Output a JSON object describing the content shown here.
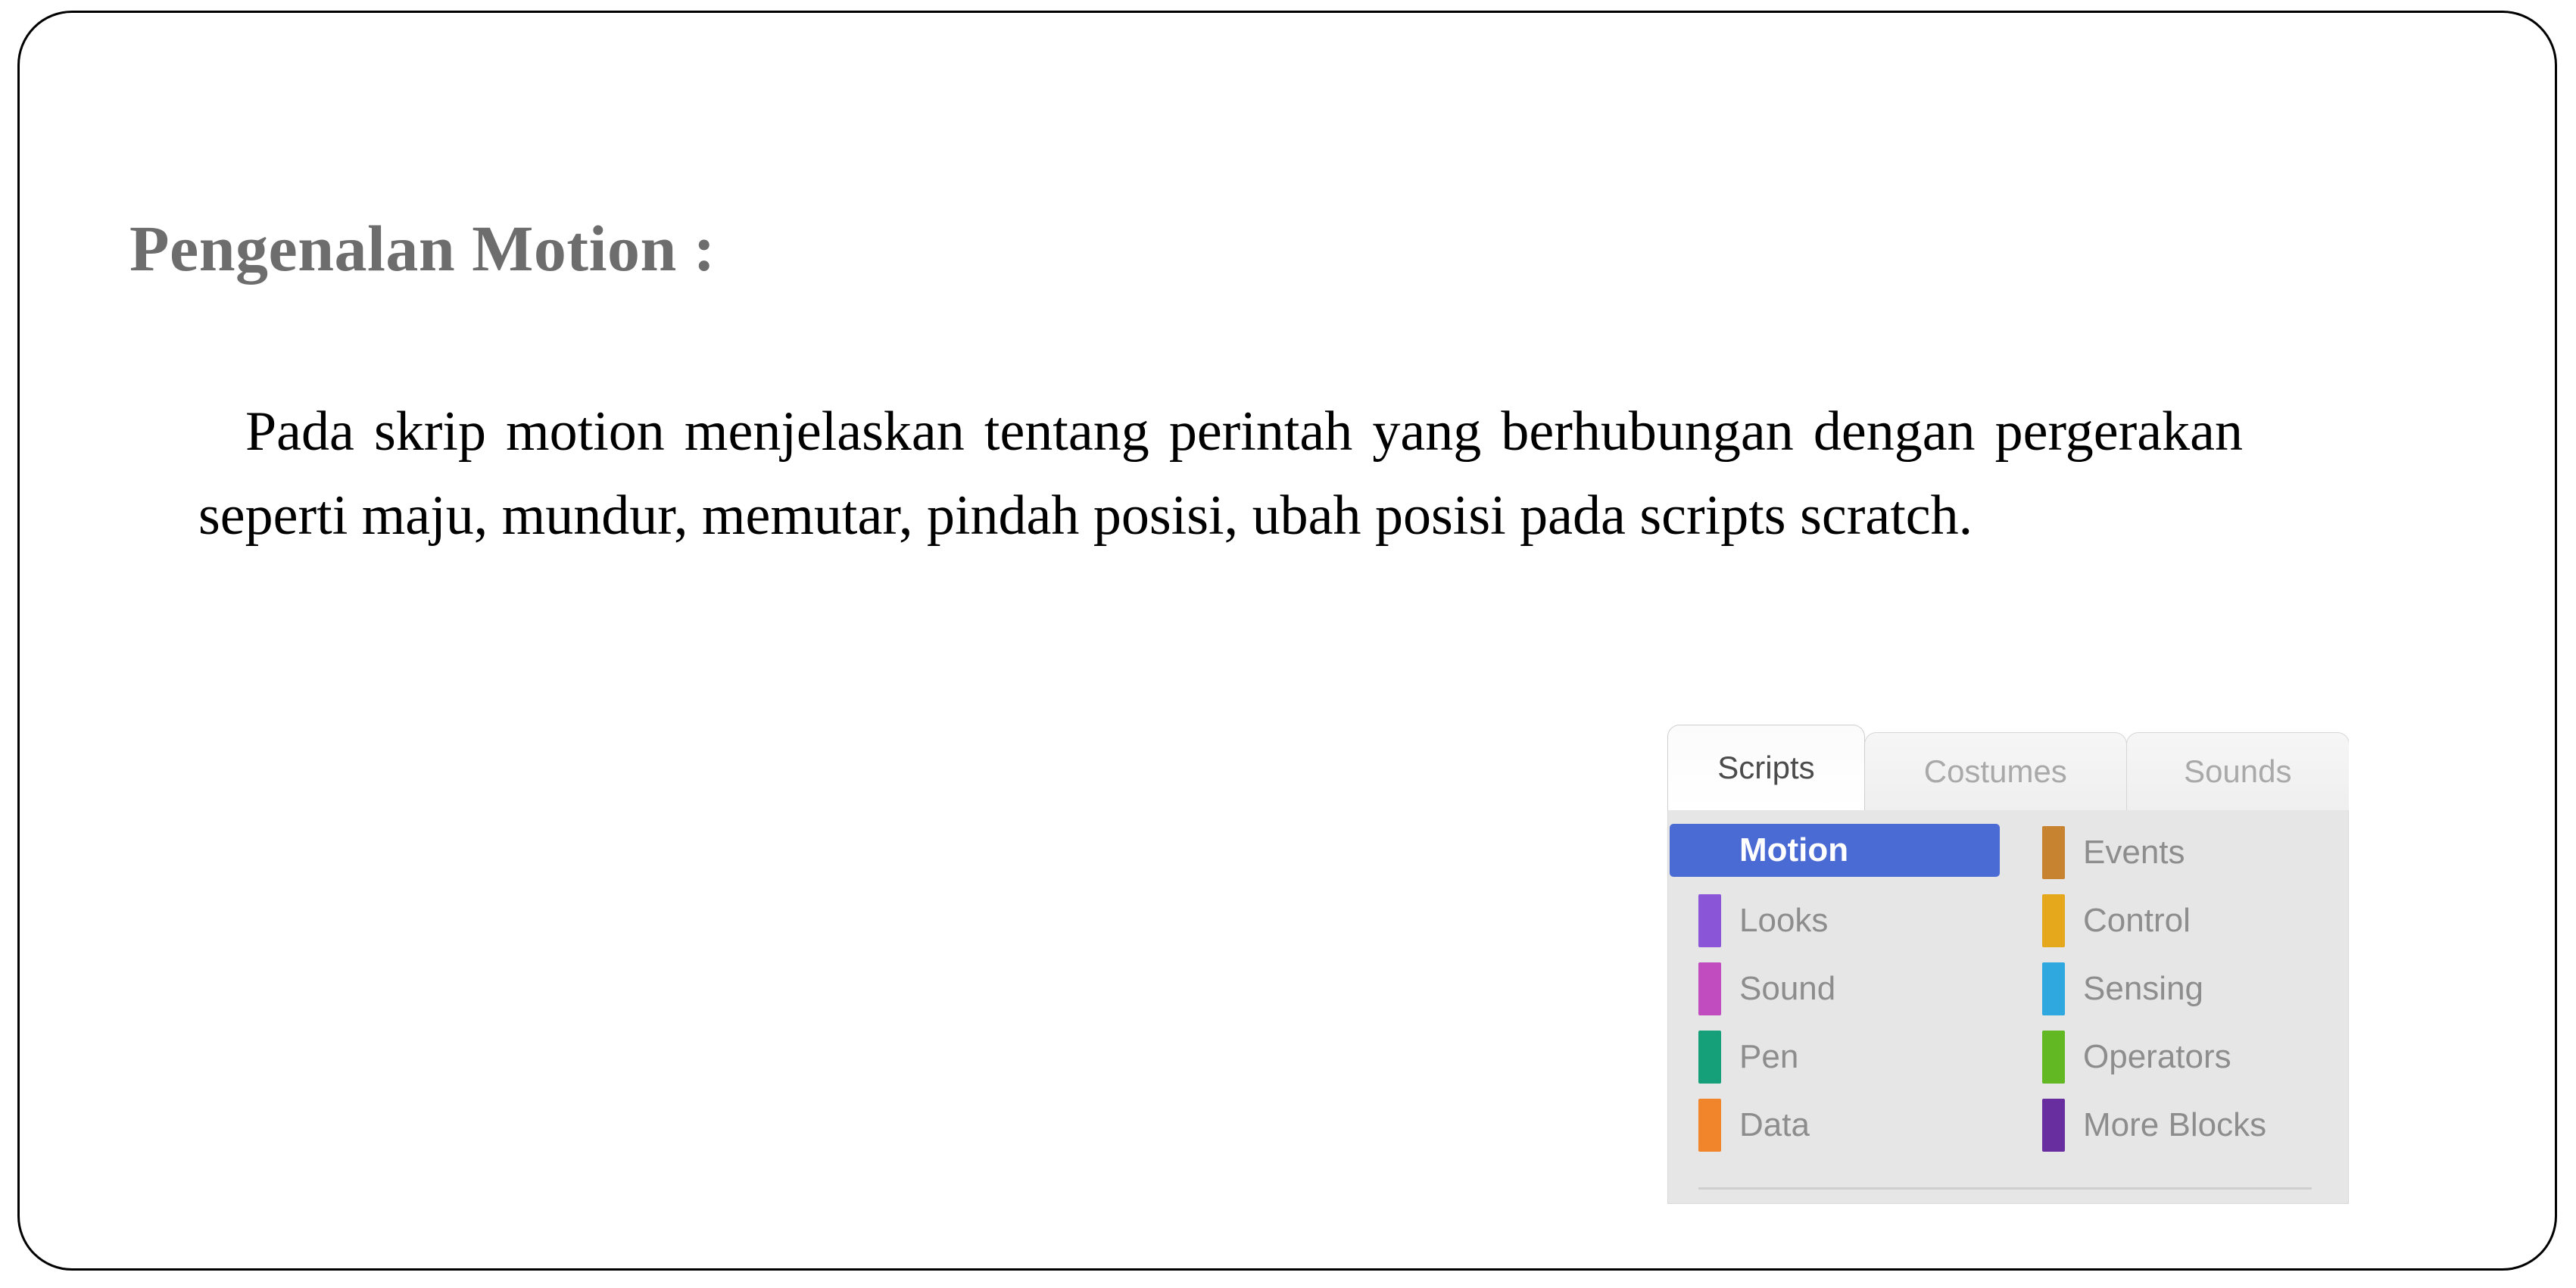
{
  "slide": {
    "title": "Pengenalan Motion :",
    "body_text": "Pada skrip motion menjelaskan tentang perintah yang berhubungan dengan pergerakan seperti maju, mundur, memutar, pindah posisi, ubah posisi pada scripts scratch.",
    "title_color": "#6e6d6d",
    "body_color": "#000000",
    "border_color": "#000000",
    "background_color": "#ffffff"
  },
  "scratch_panel": {
    "tabs": [
      {
        "label": "Scripts",
        "active": true
      },
      {
        "label": "Costumes",
        "active": false
      },
      {
        "label": "Sounds",
        "active": false
      }
    ],
    "selected_highlight_color": "#4a6bd4",
    "panel_background": "#e6e6e6",
    "categories_left": [
      {
        "label": "Motion",
        "color": "#4a6bd4",
        "selected": true
      },
      {
        "label": "Looks",
        "color": "#8a55d7",
        "selected": false
      },
      {
        "label": "Sound",
        "color": "#c04cc0",
        "selected": false
      },
      {
        "label": "Pen",
        "color": "#16a07a",
        "selected": false
      },
      {
        "label": "Data",
        "color": "#f0852b",
        "selected": false
      }
    ],
    "categories_right": [
      {
        "label": "Events",
        "color": "#c88330",
        "selected": false
      },
      {
        "label": "Control",
        "color": "#e5a81c",
        "selected": false
      },
      {
        "label": "Sensing",
        "color": "#2fa8e0",
        "selected": false
      },
      {
        "label": "Operators",
        "color": "#62b822",
        "selected": false
      },
      {
        "label": "More Blocks",
        "color": "#682ea0",
        "selected": false
      }
    ]
  }
}
